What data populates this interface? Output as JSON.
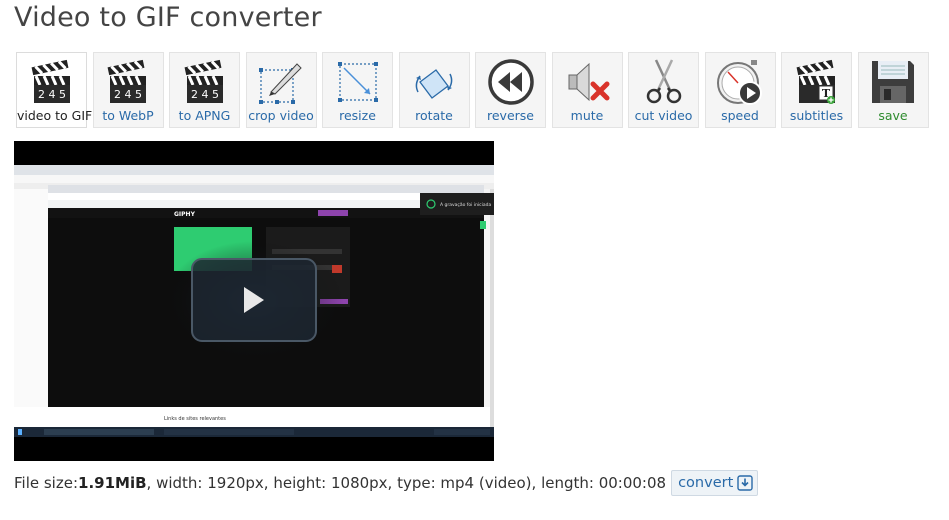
{
  "page": {
    "title": "Video to GIF converter"
  },
  "toolbar": {
    "items": [
      {
        "label": "video to GIF",
        "icon": "clapperboard-icon"
      },
      {
        "label": "to WebP",
        "icon": "clapperboard-icon"
      },
      {
        "label": "to APNG",
        "icon": "clapperboard-icon"
      },
      {
        "label": "crop video",
        "icon": "crop-icon"
      },
      {
        "label": "resize",
        "icon": "resize-icon"
      },
      {
        "label": "rotate",
        "icon": "rotate-icon"
      },
      {
        "label": "reverse",
        "icon": "reverse-icon"
      },
      {
        "label": "mute",
        "icon": "mute-icon"
      },
      {
        "label": "cut video",
        "icon": "scissors-icon"
      },
      {
        "label": "speed",
        "icon": "stopwatch-icon"
      },
      {
        "label": "subtitles",
        "icon": "subtitles-icon"
      },
      {
        "label": "save",
        "icon": "floppy-disk-icon"
      }
    ],
    "clapper_digits": "2 4 5"
  },
  "video": {
    "giphy_logo": "GIPHY",
    "notification": "A gravação foi iniciada",
    "bottom_text": "Links de sites relevantes"
  },
  "file_info": {
    "size_label": "File size: ",
    "size_value": "1.91MiB",
    "details": ", width: 1920px, height: 1080px, type: mp4 (video), length: 00:00:08",
    "convert_label": "convert"
  },
  "colors": {
    "link": "#2a6aa8",
    "save": "#2e8b2e",
    "giphy_green": "#2ecc71"
  }
}
